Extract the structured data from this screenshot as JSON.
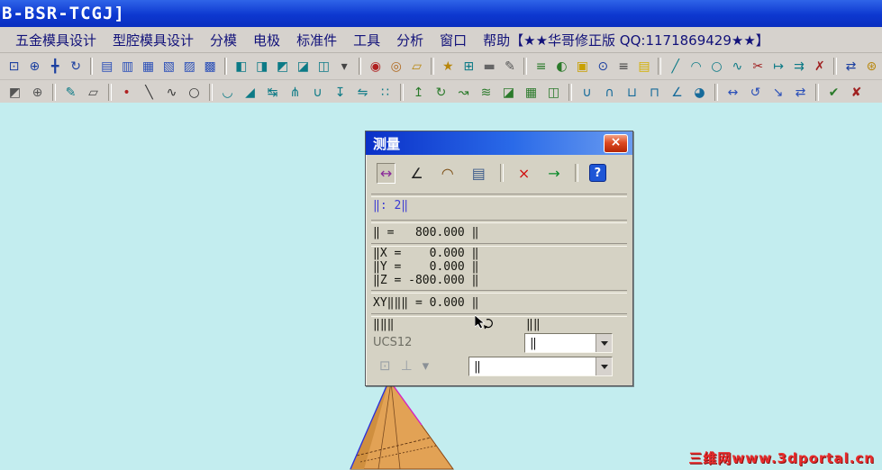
{
  "window": {
    "title": "B-BSR-TCGJ]"
  },
  "menubar": {
    "items": [
      {
        "name": "menu-hardware-mold",
        "label": "五金模具设计"
      },
      {
        "name": "menu-cavity-mold",
        "label": "型腔模具设计"
      },
      {
        "name": "menu-parting",
        "label": "分模"
      },
      {
        "name": "menu-electrode",
        "label": "电极"
      },
      {
        "name": "menu-standard-parts",
        "label": "标准件"
      },
      {
        "name": "menu-tools",
        "label": "工具"
      },
      {
        "name": "menu-analysis",
        "label": "分析"
      },
      {
        "name": "menu-window",
        "label": "窗口"
      },
      {
        "name": "menu-help",
        "label": "帮助【★★华哥修正版 QQ:1171869429★★】"
      }
    ]
  },
  "toolbars": {
    "row1": [
      {
        "name": "zoom-fit-icon",
        "glyph": "⊡",
        "color": "#1b3fa0"
      },
      {
        "name": "zoom-icon",
        "glyph": "⊕",
        "color": "#1b3fa0"
      },
      {
        "name": "pan-icon",
        "glyph": "╋",
        "color": "#1b3fa0"
      },
      {
        "name": "rotate-view-icon",
        "glyph": "↻",
        "color": "#1b3fa0"
      },
      {
        "sep": true
      },
      {
        "name": "window-cascade-icon",
        "glyph": "▤",
        "color": "#2a4fb8"
      },
      {
        "name": "window-tile-icon",
        "glyph": "▥",
        "color": "#2a4fb8"
      },
      {
        "name": "new-window-icon",
        "glyph": "▦",
        "color": "#2a4fb8"
      },
      {
        "name": "split-window-icon",
        "glyph": "▧",
        "color": "#2a4fb8"
      },
      {
        "name": "layer-settings-icon",
        "glyph": "▨",
        "color": "#2a4fb8"
      },
      {
        "name": "view-layout-icon",
        "glyph": "▩",
        "color": "#2a4fb8"
      },
      {
        "sep": true
      },
      {
        "name": "shaded-display-icon",
        "glyph": "◧",
        "color": "#0c7a86"
      },
      {
        "name": "wireframe-display-icon",
        "glyph": "◨",
        "color": "#0c7a86"
      },
      {
        "name": "hidden-line-display-icon",
        "glyph": "◩",
        "color": "#0c7a86"
      },
      {
        "name": "studio-display-icon",
        "glyph": "◪",
        "color": "#0c7a86"
      },
      {
        "name": "facet-display-icon",
        "glyph": "◫",
        "color": "#0c7a86"
      },
      {
        "name": "display-mode-arrow-icon",
        "glyph": "▾",
        "color": "#444444"
      },
      {
        "sep": true
      },
      {
        "name": "point-icon",
        "glyph": "◉",
        "color": "#b02020"
      },
      {
        "name": "point-on-curve-icon",
        "glyph": "◎",
        "color": "#b06a20"
      },
      {
        "name": "datum-plane-icon",
        "glyph": "▱",
        "color": "#b8860b"
      },
      {
        "sep": true
      },
      {
        "name": "snap-star-icon",
        "glyph": "★",
        "color": "#b8860b"
      },
      {
        "name": "grid-icon",
        "glyph": "⊞",
        "color": "#0c7a86"
      },
      {
        "name": "ruler-icon",
        "glyph": "▬",
        "color": "#666666"
      },
      {
        "name": "measure-icon",
        "glyph": "✎",
        "color": "#555555"
      },
      {
        "sep": true
      },
      {
        "name": "layer-list-icon",
        "glyph": "≡",
        "color": "#2a7a2a"
      },
      {
        "name": "show-hide-icon",
        "glyph": "◐",
        "color": "#2a7a2a"
      },
      {
        "name": "object-color-icon",
        "glyph": "▣",
        "color": "#c8a000"
      },
      {
        "name": "object-info-icon",
        "glyph": "⊙",
        "color": "#1b3fa0"
      },
      {
        "name": "list-window-icon",
        "glyph": "≡",
        "color": "#444444"
      },
      {
        "name": "palette-icon",
        "glyph": "▤",
        "color": "#d4b000"
      },
      {
        "sep": true
      },
      {
        "name": "line-icon",
        "glyph": "╱",
        "color": "#0c7a86"
      },
      {
        "name": "arc-icon",
        "glyph": "◠",
        "color": "#0c7a86"
      },
      {
        "name": "circle-icon",
        "glyph": "○",
        "color": "#0c7a86"
      },
      {
        "name": "spline-icon",
        "glyph": "∿",
        "color": "#0c7a86"
      },
      {
        "name": "scissors-trim-icon",
        "glyph": "✂",
        "color": "#a02020"
      },
      {
        "name": "extend-icon",
        "glyph": "↦",
        "color": "#0c7a86"
      },
      {
        "name": "offset-icon",
        "glyph": "⇉",
        "color": "#0c7a86"
      },
      {
        "name": "delete-icon",
        "glyph": "✗",
        "color": "#a02020"
      },
      {
        "sep": true
      },
      {
        "name": "move-object-icon",
        "glyph": "⇄",
        "color": "#1b3fa0"
      },
      {
        "name": "snap-settings-icon",
        "glyph": "⊛",
        "color": "#b8860b"
      }
    ],
    "row2": [
      {
        "name": "selection-mode-icon",
        "glyph": "◩",
        "color": "#555555"
      },
      {
        "name": "snap-toggle-icon",
        "glyph": "⊕",
        "color": "#555555"
      },
      {
        "sep": true
      },
      {
        "name": "sketch-icon",
        "glyph": "✎",
        "color": "#0c7a86"
      },
      {
        "name": "polygon-icon",
        "glyph": "▱",
        "color": "#444444"
      },
      {
        "sep": true
      },
      {
        "name": "point-tool-icon",
        "glyph": "•",
        "color": "#b02020"
      },
      {
        "name": "line-tool-icon",
        "glyph": "╲",
        "color": "#333333"
      },
      {
        "name": "curve-tool-icon",
        "glyph": "∿",
        "color": "#333333"
      },
      {
        "name": "circle-tool-icon",
        "glyph": "○",
        "color": "#333333"
      },
      {
        "sep": true
      },
      {
        "name": "fillet-icon",
        "glyph": "◡",
        "color": "#0c7a86"
      },
      {
        "name": "chamfer-icon",
        "glyph": "◢",
        "color": "#0c7a86"
      },
      {
        "name": "trim-curve-icon",
        "glyph": "↹",
        "color": "#0c7a86"
      },
      {
        "name": "divide-curve-icon",
        "glyph": "⋔",
        "color": "#0c7a86"
      },
      {
        "name": "join-curve-icon",
        "glyph": "∪",
        "color": "#0c7a86"
      },
      {
        "name": "project-curve-icon",
        "glyph": "↧",
        "color": "#0c7a86"
      },
      {
        "name": "mirror-curve-icon",
        "glyph": "⇋",
        "color": "#0c7a86"
      },
      {
        "name": "pattern-curve-icon",
        "glyph": "∷",
        "color": "#0c7a86"
      },
      {
        "sep": true
      },
      {
        "name": "extrude-icon",
        "glyph": "↥",
        "color": "#2a7a2a"
      },
      {
        "name": "revolve-icon",
        "glyph": "↻",
        "color": "#2a7a2a"
      },
      {
        "name": "sweep-icon",
        "glyph": "↝",
        "color": "#2a7a2a"
      },
      {
        "name": "loft-icon",
        "glyph": "≋",
        "color": "#2a7a2a"
      },
      {
        "name": "surface-icon",
        "glyph": "◪",
        "color": "#2a7a2a"
      },
      {
        "name": "mesh-surface-icon",
        "glyph": "▦",
        "color": "#2a7a2a"
      },
      {
        "name": "patch-surface-icon",
        "glyph": "◫",
        "color": "#2a7a2a"
      },
      {
        "sep": true
      },
      {
        "name": "unite-icon",
        "glyph": "∪",
        "color": "#156a9a"
      },
      {
        "name": "subtract-icon",
        "glyph": "∩",
        "color": "#156a9a"
      },
      {
        "name": "shell-icon",
        "glyph": "⊔",
        "color": "#156a9a"
      },
      {
        "name": "thicken-icon",
        "glyph": "⊓",
        "color": "#156a9a"
      },
      {
        "name": "draft-icon",
        "glyph": "∠",
        "color": "#156a9a"
      },
      {
        "name": "edge-blend-icon",
        "glyph": "◕",
        "color": "#156a9a"
      },
      {
        "sep": true
      },
      {
        "name": "move-icon",
        "glyph": "↔",
        "color": "#2a4fb8"
      },
      {
        "name": "rotate-object-icon",
        "glyph": "↺",
        "color": "#2a4fb8"
      },
      {
        "name": "scale-icon",
        "glyph": "↘",
        "color": "#2a4fb8"
      },
      {
        "name": "transform-icon",
        "glyph": "⇄",
        "color": "#2a4fb8"
      },
      {
        "sep": true
      },
      {
        "name": "verify-icon",
        "glyph": "✔",
        "color": "#2a7a2a"
      },
      {
        "name": "error-check-icon",
        "glyph": "✘",
        "color": "#a02020"
      }
    ]
  },
  "dialog": {
    "title": "测量",
    "close_glyph": "×",
    "toolbar": [
      {
        "name": "measure-distance-icon",
        "glyph": "↔",
        "color": "#8a2a9a",
        "pressed": true
      },
      {
        "name": "measure-angle-icon",
        "glyph": "∠",
        "color": "#222222"
      },
      {
        "name": "measure-radius-icon",
        "glyph": "◠",
        "color": "#7a4a10"
      },
      {
        "name": "measure-list-icon",
        "glyph": "▤",
        "color": "#3a5a8a"
      },
      {
        "sep": true
      },
      {
        "name": "clear-selection-icon",
        "glyph": "×",
        "color": "#d01010"
      },
      {
        "name": "export-result-icon",
        "glyph": "→",
        "color": "#0a8a2a"
      },
      {
        "sep": true
      },
      {
        "name": "help-icon",
        "glyph": "?",
        "color": "#ffffff",
        "bg": "#1e56d6"
      }
    ],
    "fields": {
      "count_line": "‖: 2‖",
      "distance_line": "‖ =   800.000 ‖",
      "dx_line": "‖X =    0.000 ‖",
      "dy_line": "‖Y =    0.000 ‖",
      "dz_line": "‖Z = -800.000 ‖",
      "xy_line": "XY‖‖‖ = 0.000 ‖",
      "left_label": "‖‖‖",
      "mid_label": "‖‖",
      "ucs_label": "UCS12",
      "combo1_value": "‖",
      "combo2_value": "‖"
    },
    "bottom_icons": [
      {
        "name": "show-point-icon",
        "glyph": "⊡",
        "color": "#9aa0a6"
      },
      {
        "name": "csys-display-icon",
        "glyph": "⊥",
        "color": "#9aa0a6"
      },
      {
        "name": "more-options-arrow-icon",
        "glyph": "▾",
        "color": "#8a9096"
      }
    ]
  },
  "watermark": {
    "text": "三维网www.3dportal.cn"
  },
  "colors": {
    "titlebar_blue": "#0d38d0",
    "canvas_cyan": "#c3edef",
    "dialog_beige": "#d5d2c4",
    "model_orange": "#e2a255",
    "watermark_red": "#e82c2c"
  }
}
